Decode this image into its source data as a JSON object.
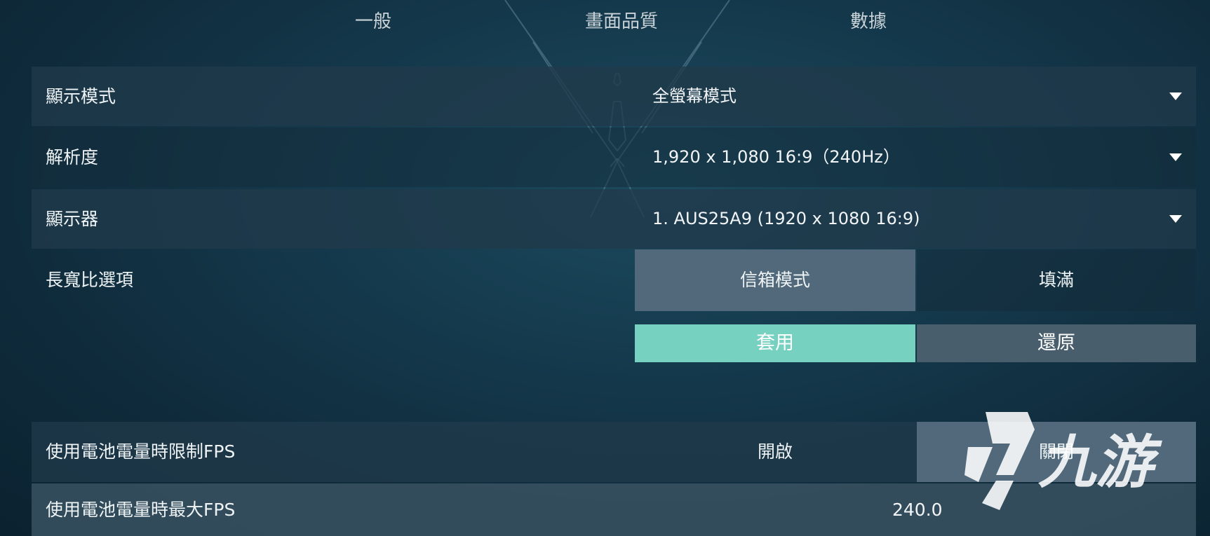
{
  "tabs": [
    {
      "label": "一般"
    },
    {
      "label": "畫面品質"
    },
    {
      "label": "數據"
    }
  ],
  "settings": {
    "display_mode": {
      "label": "顯示模式",
      "value": "全螢幕模式"
    },
    "resolution": {
      "label": "解析度",
      "value": "1,920 x 1,080 16:9（240Hz）"
    },
    "monitor": {
      "label": "顯示器",
      "value": "1. AUS25A9 (1920 x  1080 16:9)"
    },
    "aspect_ratio": {
      "label": "長寬比選項",
      "options": [
        "信箱模式",
        "填滿"
      ],
      "selected": "信箱模式"
    },
    "battery_fps_limit": {
      "label": "使用電池電量時限制FPS",
      "options": [
        "開啟",
        "關閉"
      ],
      "selected": "關閉"
    },
    "battery_max_fps": {
      "label": "使用電池電量時最大FPS",
      "value": "240.0"
    }
  },
  "actions": {
    "apply": "套用",
    "revert": "還原"
  },
  "watermark": {
    "text": "九游"
  },
  "colors": {
    "accent": "#76d1c1",
    "selected": "#51697a",
    "background": "#153a4d"
  }
}
